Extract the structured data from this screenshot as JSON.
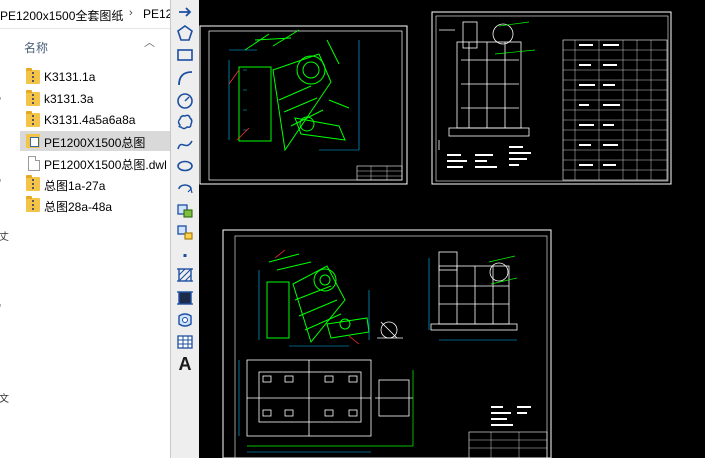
{
  "explorer": {
    "breadcrumb": [
      "PE1200x1500全套图纸",
      "PE12"
    ],
    "breadcrumb_separator": "›",
    "column_header": "名称",
    "files": [
      {
        "name": "K3131.1a",
        "type": "zip-folder"
      },
      {
        "name": "k3131.3a",
        "type": "zip-folder"
      },
      {
        "name": "K3131.4a5a6a8a",
        "type": "zip-folder"
      },
      {
        "name": "PE1200X1500总图",
        "type": "cad-folder",
        "selected": true
      },
      {
        "name": "PE1200X1500总图.dwl",
        "type": "document"
      },
      {
        "name": "总图1a-27a",
        "type": "zip-folder"
      },
      {
        "name": "总图28a-48a",
        "type": "zip-folder"
      }
    ],
    "left_edge_fragments": [
      "‘",
      "‘",
      "丈",
      "‘",
      "文"
    ]
  },
  "toolbar": {
    "tools": [
      "undo-arrow-icon",
      "polygon-icon",
      "rectangle-icon",
      "arc-icon",
      "circle-icon",
      "revision-cloud-icon",
      "spline-icon",
      "ellipse-icon",
      "ellipse-arc-icon",
      "insert-block-icon",
      "make-block-icon",
      "point-icon",
      "hatch-icon",
      "gradient-icon",
      "region-icon",
      "table-icon",
      "multiline-text-icon"
    ],
    "text_tool_label": "A"
  },
  "canvas": {
    "background": "#000000",
    "colors": {
      "sheet": "#ffffff",
      "parts": "#00ff00",
      "dims": "#00c0ff",
      "accent": "#ff3030",
      "text": "#ffffff"
    }
  }
}
